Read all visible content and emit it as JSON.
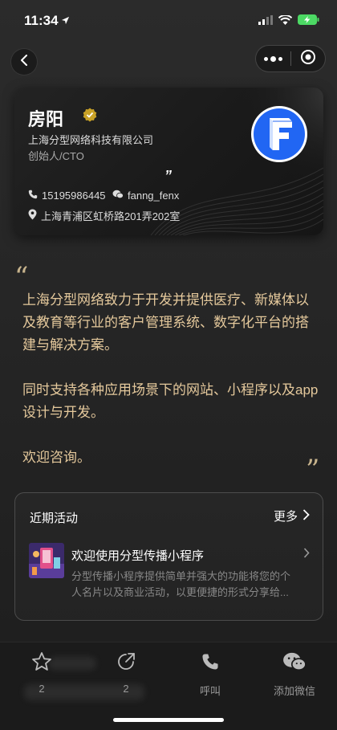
{
  "status_bar": {
    "time": "11:34"
  },
  "nav": {
    "back_icon": "chevron-left-icon",
    "more_icon": "more-dots-icon",
    "close_icon": "circle-target-icon"
  },
  "card": {
    "name": "房阳",
    "company": "上海分型网络科技有限公司",
    "title": "创始人/CTO",
    "quote_mark": "”",
    "phone": "15195986445",
    "wechat": "fanng_fenx",
    "address": "上海青浦区虹桥路201弄202室",
    "logo_letter": "F"
  },
  "intro": {
    "quote_open": "“",
    "quote_close": "”",
    "paragraphs": [
      "上海分型网络致力于开发并提供医疗、新媒体以及教育等行业的客户管理系统、数字化平台的搭建与解决方案。",
      "同时支持各种应用场景下的网站、小程序以及app设计与开发。",
      "欢迎咨询。"
    ]
  },
  "activity": {
    "section_title": "近期活动",
    "more_label": "更多",
    "items": [
      {
        "title": "欢迎使用分型传播小程序",
        "desc": "分型传播小程序提供简单并强大的功能将您的个人名片以及商业活动，以更便捷的形式分享给..."
      }
    ]
  },
  "bottom_bar": {
    "tabs": [
      {
        "label": "2",
        "icon": "star-icon"
      },
      {
        "label": "2",
        "icon": "share-icon"
      },
      {
        "label": "呼叫",
        "icon": "phone-icon"
      },
      {
        "label": "添加微信",
        "icon": "wechat-icon"
      }
    ]
  },
  "colors": {
    "accent_gold": "#e5c99c",
    "logo_blue": "#2166f3",
    "verified_gold": "#c9a227"
  }
}
